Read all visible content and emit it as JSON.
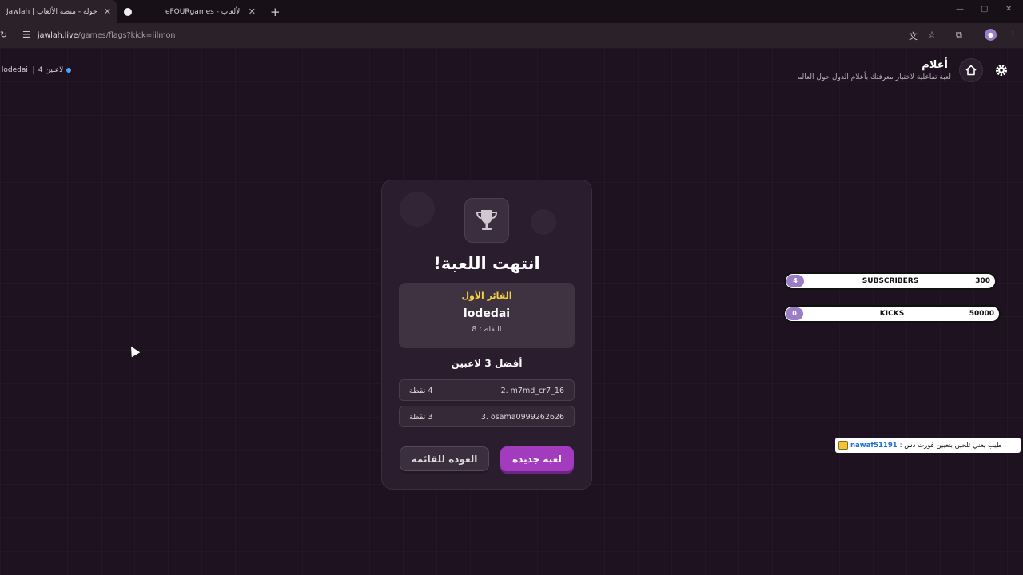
{
  "browser": {
    "tabs": [
      {
        "title": "Jawlah | جولة - منصة الألعاب",
        "active": true
      },
      {
        "title": "eFOURgames - الألعاب",
        "active": false
      }
    ],
    "url_host": "jawlah.live",
    "url_path": "/games/flags?kick=iilmon"
  },
  "header": {
    "title": "أعلام",
    "description": "لعبة تفاعلية لاختبار معرفتك بأعلام الدول حول العالم",
    "players_count": "4 لاعبين",
    "winner_label": "الفائز: lodedai"
  },
  "card": {
    "title": "انتهت اللعبة!",
    "winner_heading": "الفائز الأول",
    "winner_name": "lodedai",
    "winner_points": "النقاط: 8",
    "top_heading": "أفضل 3 لاعبين",
    "leaderboard": [
      {
        "name": "2. m7md_cr7_16",
        "points": "4 نقطة"
      },
      {
        "name": "3. osama0999262626",
        "points": "3 نقطة"
      }
    ],
    "new_game_label": "لعبة جديدة",
    "back_label": "العودة للقائمة"
  },
  "goals": [
    {
      "label": "SUBSCRIBERS",
      "current": "4",
      "target": "300",
      "progress": 0.013
    },
    {
      "label": "KICKS",
      "current": "0",
      "target": "50000",
      "progress": 0.0
    }
  ],
  "chat": {
    "user": "nawaf51191",
    "message": "طيب يعني ثلحين بتعبين فورت دس :"
  },
  "colors": {
    "accent": "#a23bbe",
    "winner_gold": "#f5d142",
    "background": "#1e1120"
  }
}
